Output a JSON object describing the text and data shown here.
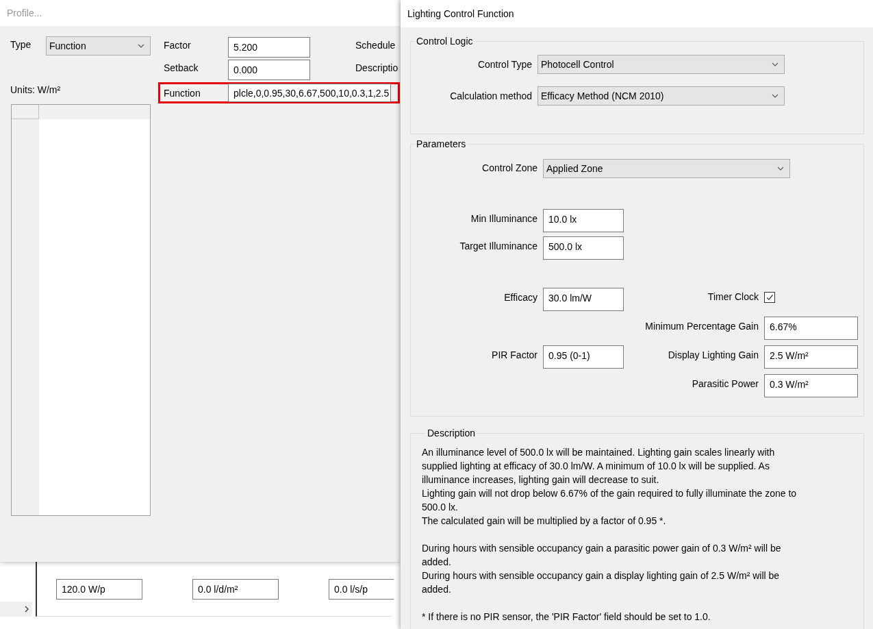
{
  "background_window": {
    "fields": [
      {
        "value": "120.0 W/p"
      },
      {
        "value": "0.0 l/d/m²"
      },
      {
        "value": "0.0 l/s/p"
      }
    ]
  },
  "profile": {
    "title": "Profile...",
    "type": {
      "label": "Type",
      "value": "Function"
    },
    "fields": [
      {
        "label": "Factor",
        "value": "5.200",
        "highlighted": false,
        "side_label": "Schedule"
      },
      {
        "label": "Setback",
        "value": "0.000",
        "highlighted": false,
        "side_label": "Descriptio"
      },
      {
        "label": "Function",
        "value": "plcle,0,0.95,30,6.67,500,10,0.3,1,2.5",
        "highlighted": true
      }
    ],
    "units_label": "Units: W/m²"
  },
  "lighting": {
    "title": "Lighting Control Function",
    "control_logic": {
      "title": "Control Logic",
      "fields": [
        {
          "label": "Control Type",
          "value": "Photocell Control"
        },
        {
          "label": "Calculation method",
          "value": "Efficacy Method (NCM 2010)"
        }
      ]
    },
    "parameters": {
      "title": "Parameters",
      "sections": [
        [
          {
            "left": {
              "kind": "dropdown",
              "label": "Control Zone",
              "value": "Applied Zone"
            }
          }
        ],
        [
          {
            "left": {
              "kind": "text",
              "label": "Min Illuminance",
              "value": "10.0 lx"
            }
          },
          {
            "left": {
              "kind": "text",
              "label": "Target Illuminance",
              "value": "500.0 lx"
            }
          }
        ],
        [
          {
            "left": {
              "kind": "text",
              "label": "Efficacy",
              "value": "30.0 lm/W"
            },
            "right": {
              "kind": "checkbox",
              "label": "Timer Clock",
              "checked": true
            }
          },
          {
            "right": {
              "kind": "text",
              "label": "Minimum Percentage Gain",
              "value": "6.67%"
            }
          },
          {
            "left": {
              "kind": "text",
              "label": "PIR Factor",
              "value": "0.95 (0-1)"
            },
            "right": {
              "kind": "text",
              "label": "Display Lighting Gain",
              "value": "2.5 W/m²"
            }
          },
          {
            "right": {
              "kind": "text",
              "label": "Parasitic Power",
              "value": "0.3 W/m²"
            }
          }
        ]
      ]
    },
    "description": {
      "title": "Description",
      "blocks": [
        [
          "An illuminance level of 500.0 lx will be maintained. Lighting gain scales linearly with supplied lighting at efficacy of 30.0 lm/W. A minimum of 10.0 lx will be supplied. As illuminance increases, lighting gain will decrease to suit.",
          "Lighting gain will not drop below 6.67% of the gain required to fully illuminate the zone to 500.0 lx.",
          "The calculated gain will be multiplied by a factor of 0.95 *."
        ],
        [
          "During hours with sensible occupancy gain a parasitic power gain of 0.3 W/m² will be added.",
          "During hours with sensible occupancy gain a display lighting gain of 2.5 W/m² will be added."
        ],
        [
          "* If there is no PIR sensor, the 'PIR Factor' field should be set to 1.0."
        ]
      ]
    }
  }
}
